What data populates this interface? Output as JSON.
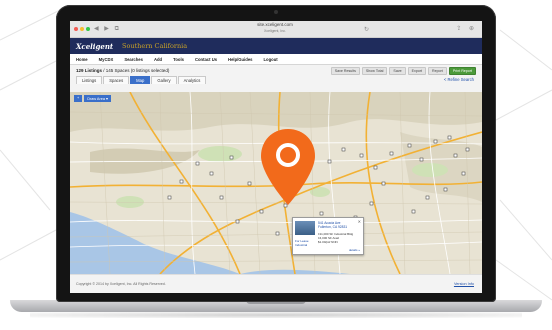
{
  "browser": {
    "url": "site.xceligent.com",
    "subtitle": "Xceligent, Inc."
  },
  "app": {
    "logo": "Xceligent",
    "market": "Southern California"
  },
  "nav": {
    "items": [
      "Home",
      "MyCDX",
      "Searches",
      "Add",
      "Tools",
      "Contact Us",
      "Help/Guides",
      "Logout"
    ]
  },
  "listings": {
    "summary_bold": "129 Listings",
    "summary_rest": "/ 145 Spaces (0 listings selected)",
    "actions": [
      "Save Results",
      "Show Total",
      "Save",
      "Export",
      "Report",
      "Print Report"
    ],
    "tabs": [
      "Listings",
      "Spaces",
      "Map",
      "Gallery",
      "Analytics"
    ],
    "active_tab": "Map",
    "refine": "< Refine Search"
  },
  "map": {
    "controls": [
      "+",
      "Draw Area ▾"
    ],
    "accent_color": "#f26a1b",
    "popup": {
      "addr1": "541 Acacia Ave",
      "addr2": "Fullerton, CA 92831",
      "line1": "±11,000 SF Industrial Bldg",
      "line2": "±4,000 SF Avail",
      "line3": "$1.00/psf NNN",
      "type1": "For Lease",
      "type2": "Industrial",
      "details": "details »",
      "close": "✕"
    }
  },
  "footer": {
    "copyright": "Copyright © 2014 by Xceligent, Inc. All Rights Reserved.",
    "version": "Version Info"
  }
}
